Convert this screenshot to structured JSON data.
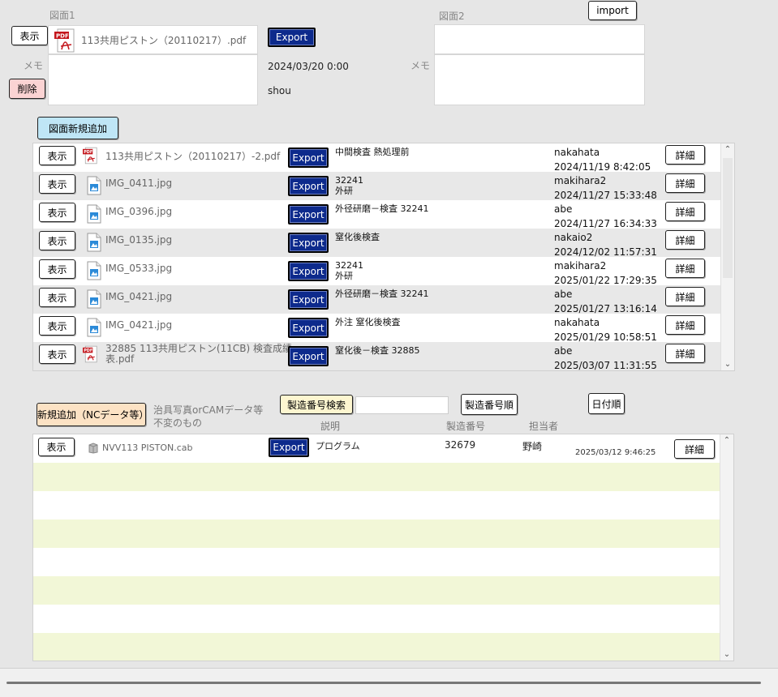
{
  "top": {
    "drawing1_label": "図面1",
    "drawing2_label": "図面2",
    "show_label": "表示",
    "delete_label": "削除",
    "memo_label1": "メモ",
    "memo_label2": "メモ",
    "file1_name": "113共用ピストン（20110217）.pdf",
    "export_label": "Export",
    "datetime": "2024/03/20 0:00",
    "user": "shou",
    "import_label": "import",
    "add_drawing_label": "図面新規追加"
  },
  "drawings": {
    "show_label": "表示",
    "export_label": "Export",
    "detail_label": "詳細",
    "rows": [
      {
        "file": "113共用ピストン（20110217）-2.pdf",
        "type": "pdf",
        "desc1": "中間検査 熱処理前",
        "desc2": "",
        "user": "nakahata",
        "date": "2024/11/19 8:42:05"
      },
      {
        "file": "IMG_0411.jpg",
        "type": "img",
        "desc1": "32241",
        "desc2": "外研",
        "user": "makihara2",
        "date": "2024/11/27 15:33:48"
      },
      {
        "file": "IMG_0396.jpg",
        "type": "img",
        "desc1": "外径研磨－検査 32241",
        "desc2": "",
        "user": "abe",
        "date": "2024/11/27 16:34:33"
      },
      {
        "file": "IMG_0135.jpg",
        "type": "img",
        "desc1": "窒化後検査",
        "desc2": "",
        "user": "nakaio2",
        "date": "2024/12/02 11:57:31"
      },
      {
        "file": "IMG_0533.jpg",
        "type": "img",
        "desc1": "32241",
        "desc2": "外研",
        "user": "makihara2",
        "date": "2025/01/22 17:29:35"
      },
      {
        "file": "IMG_0421.jpg",
        "type": "img",
        "desc1": "外径研磨－検査 32241",
        "desc2": "",
        "user": "abe",
        "date": "2025/01/27 13:16:14"
      },
      {
        "file": "IMG_0421.jpg",
        "type": "img",
        "desc1": "外注 窒化後検査",
        "desc2": "",
        "user": "nakahata",
        "date": "2025/01/29 10:58:51"
      },
      {
        "file": "32885 113共用ピストン(11CB) 検査成績表.pdf",
        "type": "pdf",
        "desc1": "窒化後－検査 32885",
        "desc2": "",
        "user": "abe",
        "date": "2025/03/07 11:31:55"
      }
    ]
  },
  "nc": {
    "add_label": "新規追加（NCデータ等）",
    "note_line1": "治具写真orCAMデータ等",
    "note_line2": "不変のもの",
    "search_label": "製造番号検索",
    "search_value": "",
    "sort_serial_label": "製造番号順",
    "sort_date_label": "日付順",
    "col_desc": "説明",
    "col_serial": "製造番号",
    "col_person": "担当者",
    "show_label": "表示",
    "export_label": "Export",
    "detail_label": "詳細",
    "rows": [
      {
        "file": "NVV113 PISTON.cab",
        "desc": "プログラム",
        "serial": "32679",
        "person": "野崎",
        "date": "2025/03/12 9:46:25"
      }
    ]
  },
  "colors": {
    "export_bg": "#0d2a8c",
    "stripe_green": "#f2f7d7",
    "row_gray": "#e8e8e8"
  }
}
